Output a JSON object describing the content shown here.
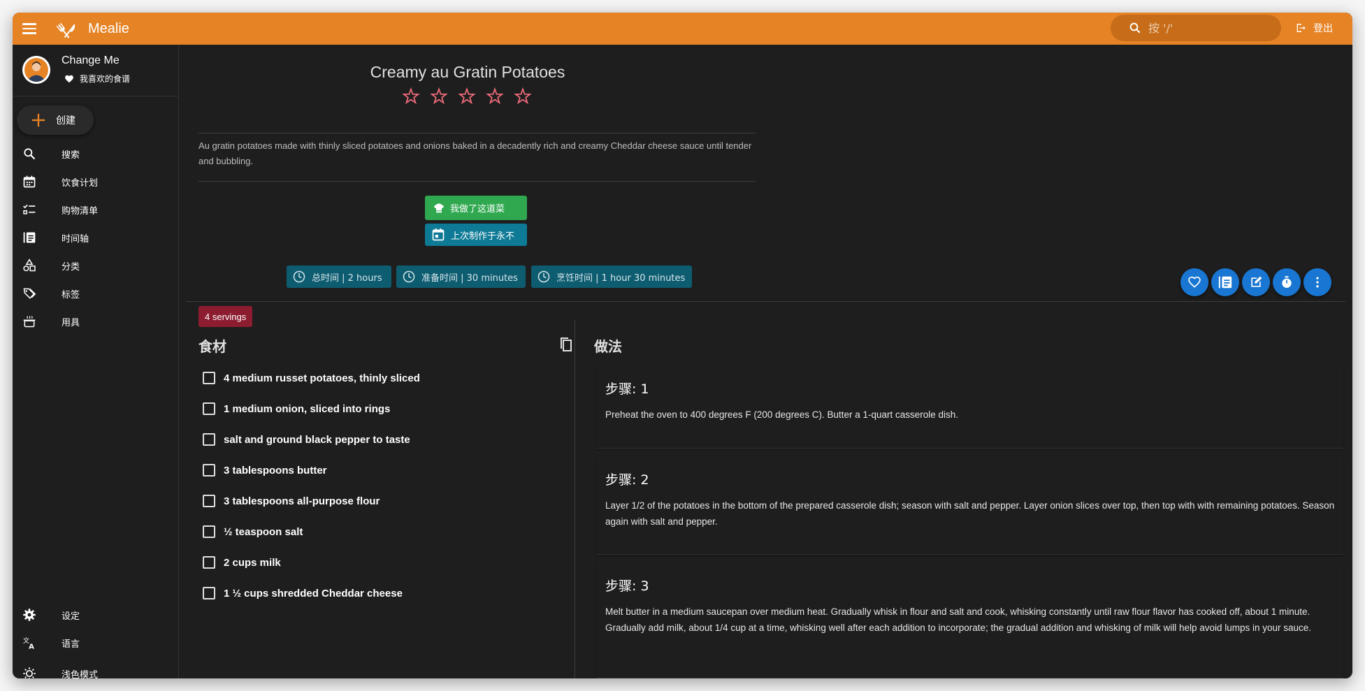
{
  "app": {
    "title": "Mealie",
    "accent": "#e58325"
  },
  "topbar": {
    "search_placeholder": "按 '/'",
    "logout_label": "登出"
  },
  "user": {
    "name": "Change Me",
    "favorites_label": "我喜欢的食谱"
  },
  "sidebar": {
    "create_label": "创建",
    "items": [
      {
        "label": "搜索",
        "icon": "search-icon"
      },
      {
        "label": "饮食计划",
        "icon": "calendar-icon"
      },
      {
        "label": "购物清单",
        "icon": "checklist-icon"
      },
      {
        "label": "时间轴",
        "icon": "timeline-icon"
      },
      {
        "label": "分类",
        "icon": "shapes-icon"
      },
      {
        "label": "标签",
        "icon": "tags-icon"
      },
      {
        "label": "用具",
        "icon": "pot-icon"
      }
    ],
    "bottom_items": [
      {
        "label": "设定",
        "icon": "gear-icon"
      },
      {
        "label": "语言",
        "icon": "translate-icon"
      },
      {
        "label": "浅色模式",
        "icon": "brightness-icon"
      }
    ]
  },
  "recipe": {
    "title": "Creamy au Gratin Potatoes",
    "rating": 0,
    "rating_max": 5,
    "description": "Au gratin potatoes made with thinly sliced potatoes and onions baked in a decadently rich and creamy Cheddar cheese sauce until tender and bubbling.",
    "made_button": "我做了这道菜",
    "last_made": "上次制作于永不",
    "times": [
      {
        "label": "总时间 | 2 hours"
      },
      {
        "label": "准备时间 | 30 minutes"
      },
      {
        "label": "烹饪时间 | 1 hour 30 minutes"
      }
    ],
    "servings": "4 servings",
    "ingredients_heading": "食材",
    "instructions_heading": "做法",
    "ingredients": [
      "4 medium russet potatoes, thinly sliced",
      "1 medium onion, sliced into rings",
      "salt and ground black pepper to taste",
      "3 tablespoons butter",
      "3 tablespoons all-purpose flour",
      "½ teaspoon salt",
      "2 cups milk",
      "1 ½ cups shredded Cheddar cheese"
    ],
    "steps": [
      {
        "title": "步骤: 1",
        "text": "Preheat the oven to 400 degrees F (200 degrees C). Butter a 1-quart casserole dish."
      },
      {
        "title": "步骤: 2",
        "text": "Layer 1/2 of the potatoes in the bottom of the prepared casserole dish; season with salt and pepper. Layer onion slices over top, then top with with remaining potatoes. Season again with salt and pepper."
      },
      {
        "title": "步骤: 3",
        "text": "Melt butter in a medium saucepan over medium heat. Gradually whisk in flour and salt and cook, whisking constantly until raw flour flavor has cooked off, about 1 minute. Gradually add milk, about 1/4 cup at a time, whisking well after each addition to incorporate; the gradual addition and whisking of milk will help avoid lumps in your sauce."
      }
    ]
  },
  "colors": {
    "made": "#2fa84f",
    "last_made": "#0e7a96",
    "time_chip": "#0e5c70",
    "fab": "#1976d2",
    "servings": "#8c1d30",
    "star": "#f06c7a"
  }
}
